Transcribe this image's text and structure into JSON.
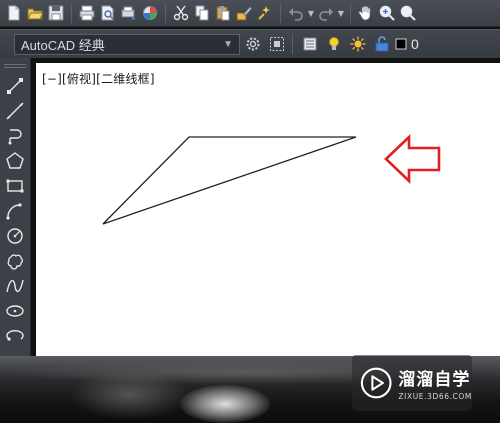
{
  "toolbar2": {
    "workspace": "AutoCAD 经典",
    "current_layer": "0"
  },
  "canvas": {
    "view_label": "[−][俯视][二维线框]"
  },
  "watermark": {
    "title": "溜溜自学",
    "subtitle": "ZIXUE.3D66.COM"
  },
  "colors": {
    "arrow": "#e02020",
    "canvas_bg": "#ffffff",
    "toolbar_bg": "#3d4148"
  }
}
